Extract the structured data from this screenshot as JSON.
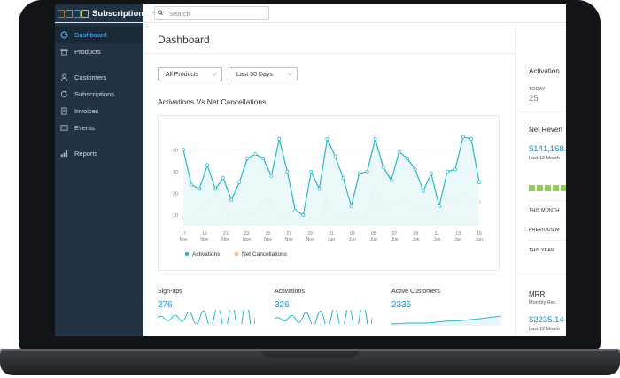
{
  "app": {
    "name": "Subscriptions"
  },
  "search": {
    "placeholder": "Search"
  },
  "sidebar": {
    "items": [
      {
        "label": "Dashboard",
        "icon": "dashboard-icon",
        "active": true
      },
      {
        "label": "Products",
        "icon": "products-icon"
      },
      {
        "label": "Customers",
        "icon": "customers-icon"
      },
      {
        "label": "Subscriptions",
        "icon": "subscriptions-icon"
      },
      {
        "label": "Invoices",
        "icon": "invoices-icon"
      },
      {
        "label": "Events",
        "icon": "events-icon"
      },
      {
        "label": "Reports",
        "icon": "reports-icon"
      }
    ]
  },
  "main": {
    "title": "Dashboard",
    "filters": {
      "product": "All Products",
      "range": "Last 30 Days"
    },
    "chart_title": "Activations Vs Net Cancellations",
    "stats": [
      {
        "label": "Sign-ups",
        "value": "276"
      },
      {
        "label": "Activations",
        "value": "326"
      },
      {
        "label": "Active Customers",
        "value": "2335"
      }
    ]
  },
  "right": {
    "activations_title": "Activation",
    "today_label": "TODAY",
    "today_value": "25",
    "net_revenue_title": "Net Reven",
    "net_revenue_value": "$141,168.",
    "net_revenue_sub": "Last 12 Month",
    "this_month": "THIS MONTH",
    "previous_month": "PREVIOUS M",
    "this_year": "THIS YEAR",
    "mrr_title": "MRR",
    "mrr_sub": "Monthly Rec",
    "mrr_value": "$2235.14",
    "mrr_sub2": "Last 12 Month"
  },
  "colors": {
    "sidebar": "#213245",
    "accent": "#1a8fd8",
    "activations": "#27b7c9",
    "cancellations": "#f5b47a"
  },
  "chart_data": {
    "type": "line",
    "y_ticks": [
      "10",
      "20",
      "30",
      "40"
    ],
    "ylim": [
      5,
      45
    ],
    "x_tick_labels": [
      [
        "17",
        "Nov"
      ],
      [
        "19",
        "Nov"
      ],
      [
        "21",
        "Nov"
      ],
      [
        "23",
        "Nov"
      ],
      [
        "25",
        "Nov"
      ],
      [
        "27",
        "Nov"
      ],
      [
        "29",
        "Nov"
      ],
      [
        "01",
        "Jun"
      ],
      [
        "03",
        "Jun"
      ],
      [
        "05",
        "Jun"
      ],
      [
        "07",
        "Jun"
      ],
      [
        "09",
        "Jun"
      ],
      [
        "11",
        "Jun"
      ],
      [
        "13",
        "Jun"
      ],
      [
        "15",
        "Jun"
      ]
    ],
    "series": [
      {
        "name": "Activations",
        "color": "#27b7c9",
        "values": [
          40,
          24,
          22,
          33,
          22,
          27,
          17,
          25,
          36,
          38,
          36,
          28,
          45,
          30,
          12,
          10,
          30,
          22,
          45,
          37,
          27,
          14,
          29,
          30,
          45,
          32,
          26,
          39,
          36,
          31,
          21,
          29,
          14,
          30,
          31,
          46,
          45,
          25
        ]
      },
      {
        "name": "Net Cancellations",
        "color": "#f5b47a",
        "values": [
          9,
          7,
          11,
          17,
          19,
          18,
          6,
          12,
          11,
          11,
          18,
          17,
          9,
          10,
          7,
          6,
          9,
          8,
          18,
          9,
          9,
          9,
          9,
          12,
          24,
          13,
          15,
          17,
          16,
          14,
          12,
          15,
          10,
          17,
          17,
          20,
          15,
          16
        ]
      }
    ],
    "legend": "bottom-left"
  }
}
